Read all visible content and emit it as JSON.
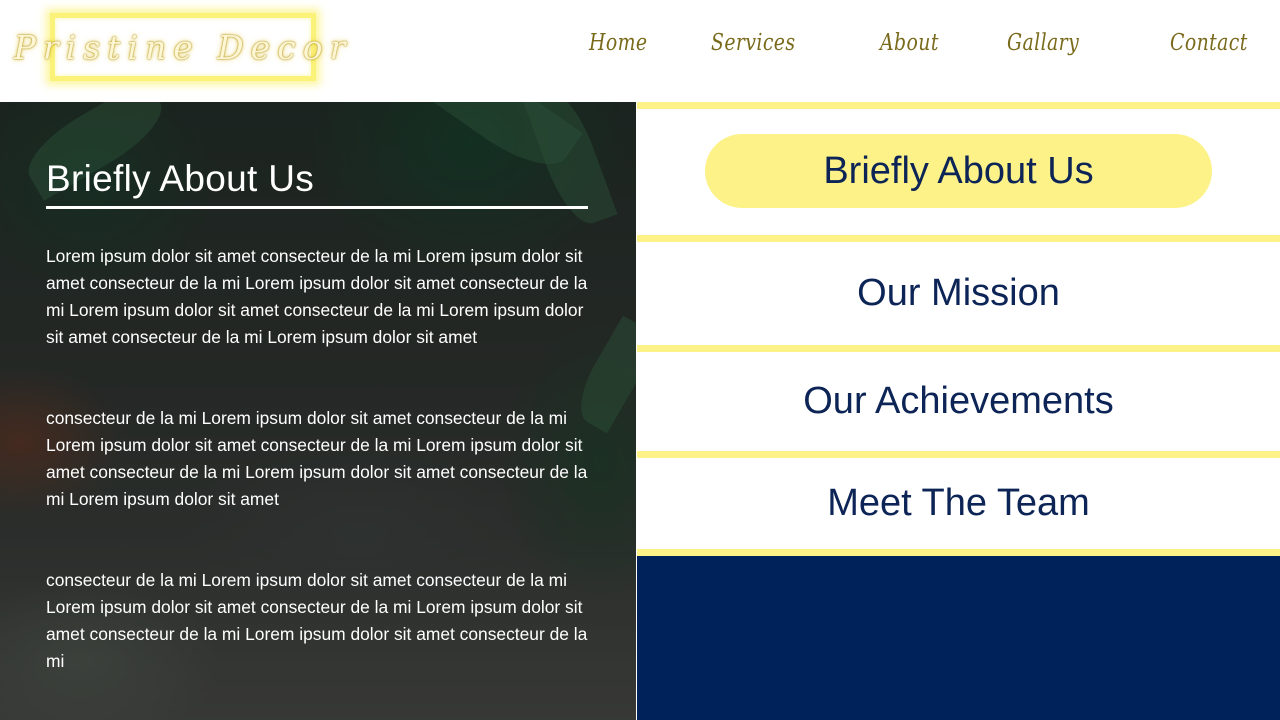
{
  "header": {
    "logo_text": "Pristine Decor",
    "nav": [
      {
        "label": "Home"
      },
      {
        "label": "Services"
      },
      {
        "label": "About"
      },
      {
        "label": "Gallary"
      },
      {
        "label": "Contact"
      }
    ]
  },
  "about": {
    "title": "Briefly About Us",
    "paragraphs": [
      "Lorem ipsum dolor sit amet consecteur de la mi Lorem ipsum dolor sit amet consecteur de la mi Lorem ipsum dolor sit amet consecteur de la mi  Lorem ipsum dolor sit amet consecteur de la mi Lorem ipsum dolor sit amet consecteur de la mi Lorem ipsum dolor sit amet",
      "consecteur de la mi Lorem ipsum dolor sit amet consecteur de la mi Lorem ipsum dolor sit amet consecteur de la mi Lorem ipsum dolor sit amet consecteur de la mi  Lorem ipsum dolor sit amet consecteur de la mi Lorem ipsum dolor sit amet",
      "consecteur de la mi Lorem ipsum dolor sit amet consecteur de la mi  Lorem ipsum dolor sit amet consecteur de la mi Lorem ipsum dolor sit amet consecteur de la mi Lorem ipsum dolor sit amet consecteur de la mi"
    ]
  },
  "side_menu": {
    "active_label": "Briefly About Us",
    "items": [
      {
        "label": "Our Mission"
      },
      {
        "label": "Our Achievements"
      },
      {
        "label": "Meet The Team"
      }
    ]
  },
  "colors": {
    "accent_yellow": "#fcf287",
    "navy": "#00225a",
    "menu_text": "#0d2456",
    "nav_text": "#7a6a1c"
  }
}
